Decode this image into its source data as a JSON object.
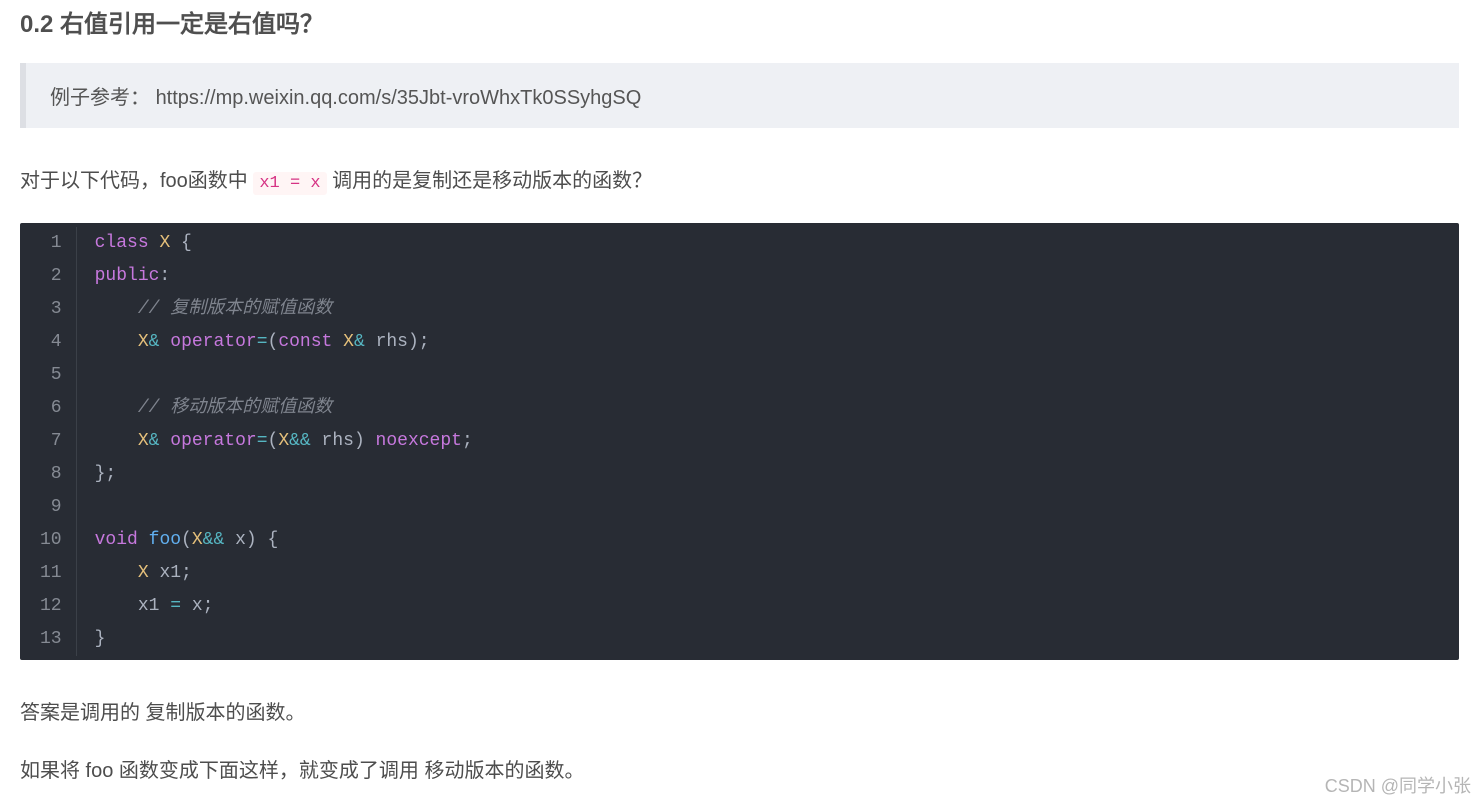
{
  "heading": "0.2 右值引用一定是右值吗？",
  "quote": {
    "prefix": "例子参考：",
    "url": "https://mp.weixin.qq.com/s/35Jbt-vroWhxTk0SSyhgSQ"
  },
  "para1": {
    "before": "对于以下代码，foo函数中 ",
    "code": "x1 = x",
    "after": " 调用的是复制还是移动版本的函数？"
  },
  "code_lines": [
    {
      "n": "1",
      "tokens": [
        [
          "kw",
          "class"
        ],
        [
          "pl",
          " "
        ],
        [
          "cls",
          "X"
        ],
        [
          "pl",
          " {"
        ]
      ]
    },
    {
      "n": "2",
      "tokens": [
        [
          "kw",
          "public"
        ],
        [
          "pl",
          ":"
        ]
      ]
    },
    {
      "n": "3",
      "tokens": [
        [
          "pl",
          "    "
        ],
        [
          "cmt",
          "// 复制版本的赋值函数"
        ]
      ]
    },
    {
      "n": "4",
      "tokens": [
        [
          "pl",
          "    "
        ],
        [
          "cls",
          "X"
        ],
        [
          "op",
          "&"
        ],
        [
          "pl",
          " "
        ],
        [
          "kw",
          "operator"
        ],
        [
          "op",
          "="
        ],
        [
          "pl",
          "("
        ],
        [
          "kw",
          "const"
        ],
        [
          "pl",
          " "
        ],
        [
          "cls",
          "X"
        ],
        [
          "op",
          "&"
        ],
        [
          "pl",
          " rhs);"
        ]
      ]
    },
    {
      "n": "5",
      "tokens": [
        [
          "pl",
          ""
        ]
      ]
    },
    {
      "n": "6",
      "tokens": [
        [
          "pl",
          "    "
        ],
        [
          "cmt",
          "// 移动版本的赋值函数"
        ]
      ]
    },
    {
      "n": "7",
      "tokens": [
        [
          "pl",
          "    "
        ],
        [
          "cls",
          "X"
        ],
        [
          "op",
          "&"
        ],
        [
          "pl",
          " "
        ],
        [
          "kw",
          "operator"
        ],
        [
          "op",
          "="
        ],
        [
          "pl",
          "("
        ],
        [
          "cls",
          "X"
        ],
        [
          "op",
          "&&"
        ],
        [
          "pl",
          " rhs) "
        ],
        [
          "kw",
          "noexcept"
        ],
        [
          "pl",
          ";"
        ]
      ]
    },
    {
      "n": "8",
      "tokens": [
        [
          "pl",
          "};"
        ]
      ]
    },
    {
      "n": "9",
      "tokens": [
        [
          "pl",
          ""
        ]
      ]
    },
    {
      "n": "10",
      "tokens": [
        [
          "kw",
          "void"
        ],
        [
          "pl",
          " "
        ],
        [
          "fn",
          "foo"
        ],
        [
          "pl",
          "("
        ],
        [
          "cls",
          "X"
        ],
        [
          "op",
          "&&"
        ],
        [
          "pl",
          " x) {"
        ]
      ]
    },
    {
      "n": "11",
      "tokens": [
        [
          "pl",
          "    "
        ],
        [
          "cls",
          "X"
        ],
        [
          "pl",
          " x1;"
        ]
      ]
    },
    {
      "n": "12",
      "tokens": [
        [
          "pl",
          "    x1 "
        ],
        [
          "op",
          "="
        ],
        [
          "pl",
          " x;"
        ]
      ]
    },
    {
      "n": "13",
      "tokens": [
        [
          "pl",
          "}"
        ]
      ]
    }
  ],
  "para2": "答案是调用的 复制版本的函数。",
  "para3": "如果将 foo 函数变成下面这样，就变成了调用 移动版本的函数。",
  "watermark": "CSDN @同学小张"
}
